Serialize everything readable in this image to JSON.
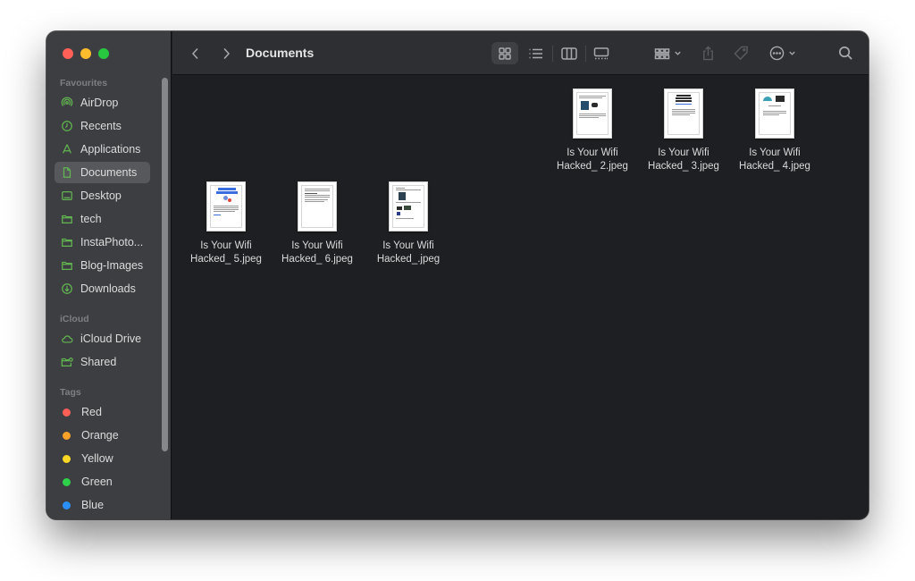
{
  "window": {
    "title": "Documents",
    "traffic_lights": [
      "close",
      "minimize",
      "zoom"
    ]
  },
  "sidebar": {
    "sections": [
      {
        "label": "Favourites",
        "items": [
          {
            "label": "AirDrop",
            "icon": "airdrop-icon"
          },
          {
            "label": "Recents",
            "icon": "clock-icon"
          },
          {
            "label": "Applications",
            "icon": "applications-icon"
          },
          {
            "label": "Documents",
            "icon": "document-icon",
            "active": true
          },
          {
            "label": "Desktop",
            "icon": "desktop-icon"
          },
          {
            "label": "tech",
            "icon": "folder-icon"
          },
          {
            "label": "InstaPhoto...",
            "icon": "folder-icon"
          },
          {
            "label": "Blog-Images",
            "icon": "folder-icon"
          },
          {
            "label": "Downloads",
            "icon": "download-icon"
          }
        ]
      },
      {
        "label": "iCloud",
        "items": [
          {
            "label": "iCloud Drive",
            "icon": "cloud-icon"
          },
          {
            "label": "Shared",
            "icon": "shared-folder-icon"
          }
        ]
      },
      {
        "label": "Tags",
        "items": [
          {
            "label": "Red",
            "color": "#fe5f57"
          },
          {
            "label": "Orange",
            "color": "#f7a12a"
          },
          {
            "label": "Yellow",
            "color": "#fdd825"
          },
          {
            "label": "Green",
            "color": "#2fd14b"
          },
          {
            "label": "Blue",
            "color": "#2a8ff7"
          }
        ]
      }
    ]
  },
  "toolbar": {
    "back_icon": "chevron-left-icon",
    "forward_icon": "chevron-right-icon",
    "title": "Documents",
    "views": [
      "icon-view",
      "list-view",
      "column-view",
      "gallery-view"
    ],
    "active_view": "icon-view",
    "actions": [
      "group-by",
      "share",
      "tags",
      "more-actions",
      "search"
    ]
  },
  "files": [
    {
      "line1": "Is Your Wifi",
      "line2": "Hacked_ 2.jpeg",
      "thumb": "laptop-person"
    },
    {
      "line1": "Is Your Wifi",
      "line2": "Hacked_ 3.jpeg",
      "thumb": "headline-text"
    },
    {
      "line1": "Is Your Wifi",
      "line2": "Hacked_ 4.jpeg",
      "thumb": "wifi-slow"
    },
    {
      "line1": "Is Your Wifi",
      "line2": "Hacked_ 5.jpeg",
      "thumb": "changed-settings"
    },
    {
      "line1": "Is Your Wifi",
      "line2": "Hacked_ 6.jpeg",
      "thumb": "text-only"
    },
    {
      "line1": "Is Your Wifi",
      "line2": "Hacked_.jpeg",
      "thumb": "hacker-diagram"
    }
  ],
  "colors": {
    "accent_icon": "#62b651",
    "sidebar_bg": "#3d3e41",
    "content_bg": "#1e1f22",
    "toolbar_bg": "#2e2f33"
  }
}
